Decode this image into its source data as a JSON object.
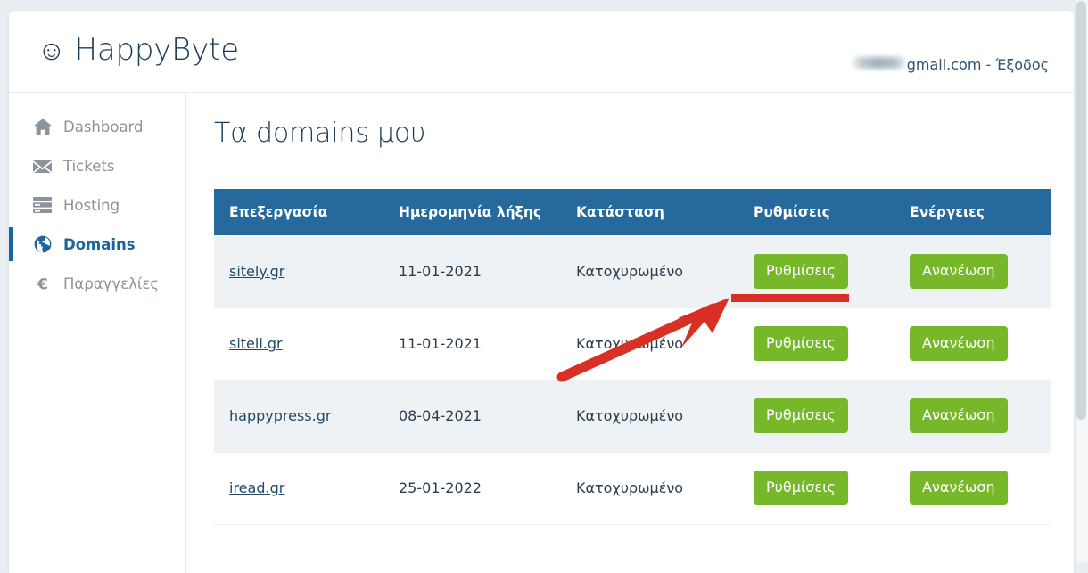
{
  "header": {
    "brand_smiley": "☺",
    "brand_name": "HappyByte",
    "brand_icon_name": "smiley-face-icon",
    "account_text": "gmail.com - Έξοδος",
    "account_redacted": true
  },
  "sidebar": {
    "items": [
      {
        "label": "Dashboard",
        "icon": "home-icon",
        "active": false
      },
      {
        "label": "Tickets",
        "icon": "envelope-icon",
        "active": false
      },
      {
        "label": "Hosting",
        "icon": "server-icon",
        "active": false
      },
      {
        "label": "Domains",
        "icon": "globe-icon",
        "active": true
      },
      {
        "label": "Παραγγελίες",
        "icon": "euro-icon",
        "active": false
      }
    ]
  },
  "main": {
    "page_title": "Τα domains μου",
    "table": {
      "columns": [
        "Επεξεργασία",
        "Ημερομηνία λήξης",
        "Κατάσταση",
        "Ρυθμίσεις",
        "Ενέργειες"
      ],
      "rows": [
        {
          "domain": "sitely.gr",
          "expiry": "11-01-2021",
          "status": "Κατοχυρωμένο",
          "settings_label": "Ρυθμίσεις",
          "action_label": "Ανανέωση",
          "striped": true,
          "highlighted": true
        },
        {
          "domain": "siteli.gr",
          "expiry": "11-01-2021",
          "status": "Κατοχυρωμένο",
          "settings_label": "Ρυθμίσεις",
          "action_label": "Ανανέωση",
          "striped": false,
          "highlighted": false
        },
        {
          "domain": "happypress.gr",
          "expiry": "08-04-2021",
          "status": "Κατοχυρωμένο",
          "settings_label": "Ρυθμίσεις",
          "action_label": "Ανανέωση",
          "striped": true,
          "highlighted": false
        },
        {
          "domain": "iread.gr",
          "expiry": "25-01-2022",
          "status": "Κατοχυρωμένο",
          "settings_label": "Ρυθμίσεις",
          "action_label": "Ανανέωση",
          "striped": false,
          "highlighted": false
        }
      ]
    }
  },
  "annotation": {
    "type": "red-arrow-with-underline",
    "target": "settings-button-row-1",
    "color": "#d93025"
  },
  "colors": {
    "brand_navy": "#1d3b55",
    "table_header_blue": "#26699c",
    "button_green": "#76b82a",
    "sidebar_text": "#8b949b",
    "active_blue": "#1a659e",
    "page_background": "#e9eef1",
    "stripe": "#eef2f5",
    "annotation_red": "#d93025"
  }
}
